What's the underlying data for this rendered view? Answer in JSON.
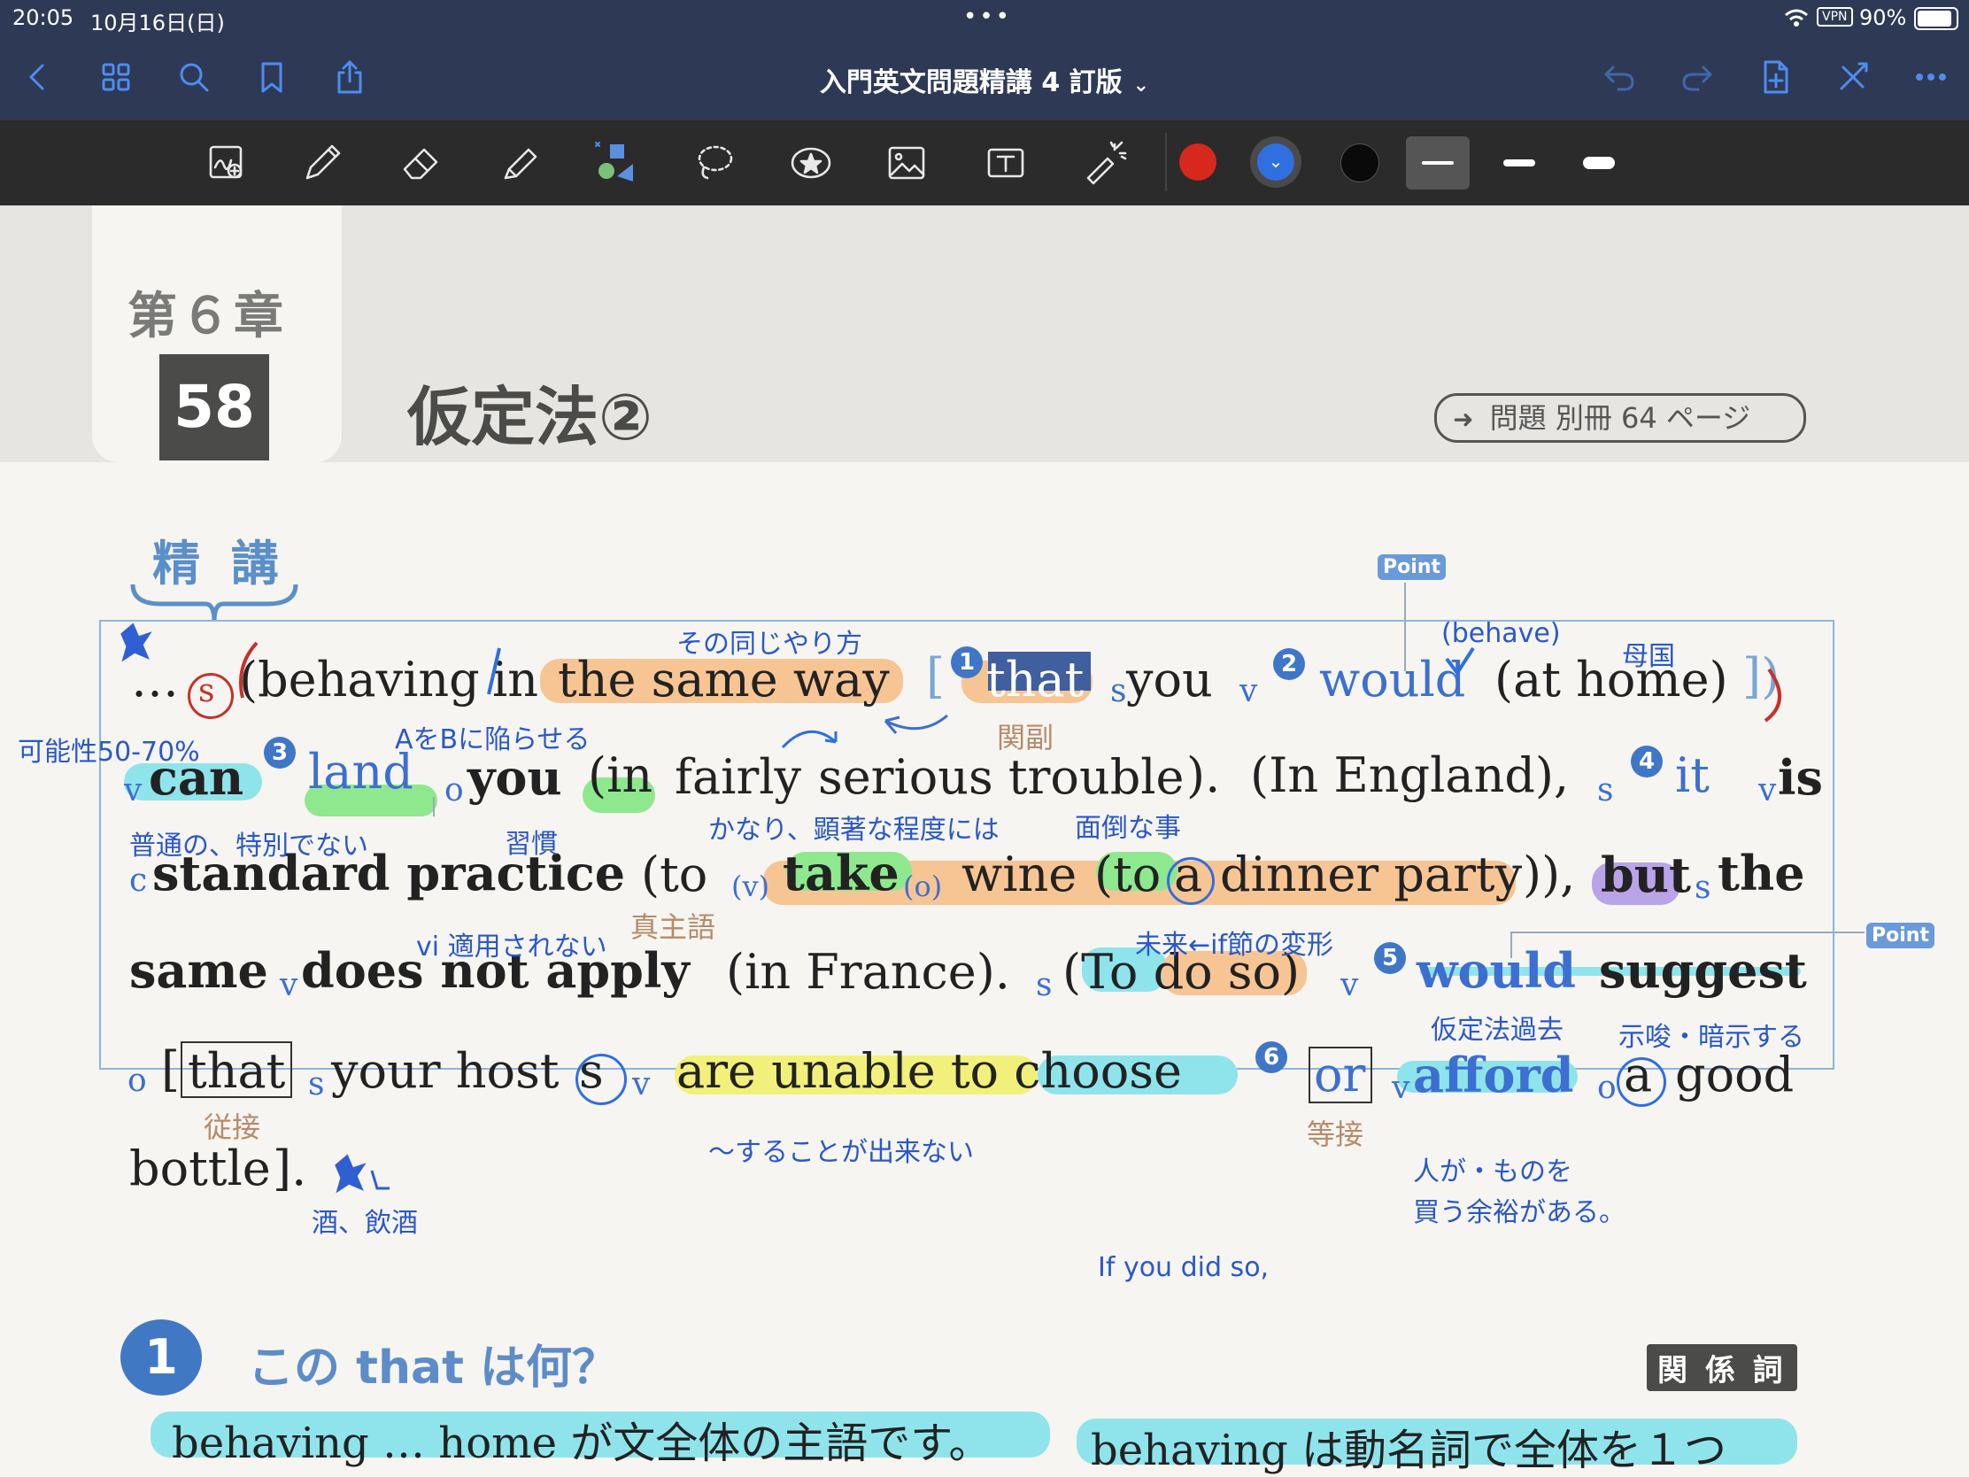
{
  "status": {
    "time": "20:05",
    "date": "10月16日(日)",
    "vpn": "VPN",
    "battery": "90%"
  },
  "nav": {
    "title": "入門英文問題精講 4 訂版"
  },
  "toolbar": {
    "colors": [
      "#d6281c",
      "#2f6fe0",
      "#0a0a0a"
    ]
  },
  "page": {
    "chapter": "第６章",
    "section_number": "58",
    "section_title": "仮定法②",
    "problem_ref": "問題 別冊 64 ページ",
    "seikou": "精 講",
    "point_labels": [
      "Point",
      "Point"
    ],
    "lines": [
      [
        "…",
        "(behaving",
        "in",
        "the same way",
        "[",
        "that",
        "you",
        "would",
        "(at home)",
        "])"
      ],
      [
        "can",
        "land",
        "you",
        "(in",
        "fairly",
        "serious trouble",
        ").",
        "(In England),",
        "it",
        "is"
      ],
      [
        "standard practice",
        "(to",
        "take",
        "wine",
        "(to",
        "a",
        "dinner party",
        ")),",
        "but",
        "the"
      ],
      [
        "same",
        "does not apply",
        "(in France).",
        "(To do so)",
        "would",
        "suggest"
      ],
      [
        "[",
        "that",
        "your host",
        "s",
        "are unable to choose",
        "or",
        "afford",
        "a",
        "good"
      ],
      [
        "bottle",
        "]."
      ]
    ],
    "grammar_marks": {
      "s1": "s",
      "s2": "s",
      "s3": "s",
      "s4": "s",
      "s5": "s",
      "v1": "v",
      "v2": "v",
      "v3": "v",
      "v4": "v",
      "v5": "v",
      "v6": "v",
      "v7": "v",
      "o1": "o",
      "o2": "o",
      "o3": "o",
      "c1": "c",
      "v_paren": "(v)",
      "o_paren": "(o)"
    },
    "badges": [
      "1",
      "2",
      "3",
      "4",
      "5",
      "6"
    ],
    "tan_notes": [
      "関副",
      "真主語",
      "従接",
      "等接"
    ],
    "annotations": {
      "sono_onaji": "その同じやり方",
      "behave": "(behave)",
      "bokoku": "母国",
      "kanousei": "可能性50-70%",
      "a_wo_b": "AをBに陥らせる",
      "futsuu": "普通の、特別でない",
      "shuukan": "習慣",
      "kanari": "かなり、顕著な程度には",
      "mendou": "面倒な事",
      "vi": "vi 適用されない",
      "mirai": "未来←if節の変形",
      "kateihou": "仮定法過去",
      "shisa": "示唆・暗示する",
      "dekinai": "〜することが出来ない",
      "hito_ga": "人が・ものを",
      "kau_yoyuu": "買う余裕がある。",
      "sake": "酒、飲酒",
      "if_you": "If you did so,"
    },
    "q1_badge": "1",
    "q1_title": "この that は何？",
    "q1_tag": "関 係 詞",
    "bottom_text_1": "behaving … home が文全体の主語です。",
    "bottom_text_2": "behaving は動名詞で全体を１つ"
  }
}
